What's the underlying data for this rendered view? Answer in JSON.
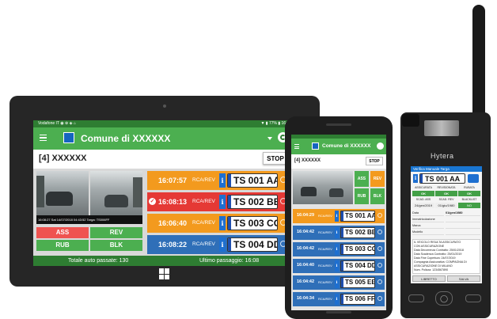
{
  "tablet": {
    "status_left": "Vodafone IT ◉ ⊕ ◈ ⌂",
    "status_right": "▼ ▮ 77% ▮ 16:08",
    "title": "Comune di XXXXXX",
    "subtitle": "[4] XXXXXX",
    "stop_label": "STOP",
    "cam_caption": "16:08:27 Sat 14/07/2018 04:43:52 Targa: TS006FF",
    "buttons": [
      "ASS",
      "REV",
      "RUB",
      "BLK"
    ],
    "rows": [
      {
        "time": "16:07:57",
        "type": "RCA/REV",
        "plate": "TS 001 AA",
        "color": "#f39a1e"
      },
      {
        "time": "16:08:13",
        "type": "RCA/REV",
        "plate": "TS 002 BB",
        "color": "#e53935",
        "check": true
      },
      {
        "time": "16:06:40",
        "type": "RCA/REV",
        "plate": "TS 003 CC",
        "color": "#f39a1e"
      },
      {
        "time": "16:08:22",
        "type": "RCA/REV",
        "plate": "TS 004 DD",
        "color": "#2f6fb8"
      }
    ],
    "footer_left": "Totale auto passate: 130",
    "footer_right": "Ultimo passaggio: 16:08",
    "colors": {
      "green": "#4caf50",
      "dark_green": "#2e7d32",
      "frame": "#262626"
    }
  },
  "phone": {
    "title": "Comune di XXXXXX",
    "subtitle": "[4] XXXXXX",
    "stop_label": "STOP",
    "buttons": [
      "ASS",
      "REV",
      "RUB",
      "BLK"
    ],
    "rows": [
      {
        "time": "16:04:29",
        "type": "RCA/REV",
        "plate": "TS 001 AA",
        "color": "#f39a1e"
      },
      {
        "time": "16:04:42",
        "type": "RCA/REV",
        "plate": "TS 002 BB",
        "color": "#2f6fb8"
      },
      {
        "time": "16:04:42",
        "type": "RCA/REV",
        "plate": "TS 003 CC",
        "color": "#2f6fb8"
      },
      {
        "time": "16:04:40",
        "type": "RCA/REV",
        "plate": "TS 004 DD",
        "color": "#2f6fb8"
      },
      {
        "time": "16:04:42",
        "type": "RCA/REV",
        "plate": "TS 005 EE",
        "color": "#2f6fb8"
      },
      {
        "time": "16:04:34",
        "type": "RCA/REV",
        "plate": "TS 006 FF",
        "color": "#2f6fb8"
      }
    ]
  },
  "radio": {
    "brand": "Hytera",
    "header": "Verifica Manuale Targa",
    "plate": "TS 001 AA",
    "grid_labels": [
      "ASSICURATA",
      "REVISIONATA",
      "RUBATA"
    ],
    "grid_values": [
      "OK",
      "OK",
      "OK"
    ],
    "grid2_labels": [
      "SCAD. ASS",
      "SCAD. REV",
      "BLACKLIST"
    ],
    "grid2_values": [
      "24/gen/2019",
      "01/giu/1980",
      "NO"
    ],
    "info_rows": [
      {
        "label": "Data",
        "value": "01/gen/1980"
      },
      {
        "label": "Immatricolazione",
        "value": ""
      },
      {
        "label": "Marca",
        "value": ""
      },
      {
        "label": "Modello",
        "value": ""
      }
    ],
    "notes": [
      "IL VEICOLO RISULTA ASSICURATO",
      "CON ASSICURAZIONE",
      "Data Decorrenza Contratto: 25/01/2018",
      "Data Scadenza Contratto: 25/01/2019",
      "Data Fine Copertura: 24/07/2019",
      "Compagnia Assicurativa: COMPAGNIA DI",
      "ASSICURAZIONE DI MILANO",
      "Num. Polizza: 1234567890"
    ],
    "btn_left": "LIBRETTO",
    "btn_right": "SALVA"
  }
}
